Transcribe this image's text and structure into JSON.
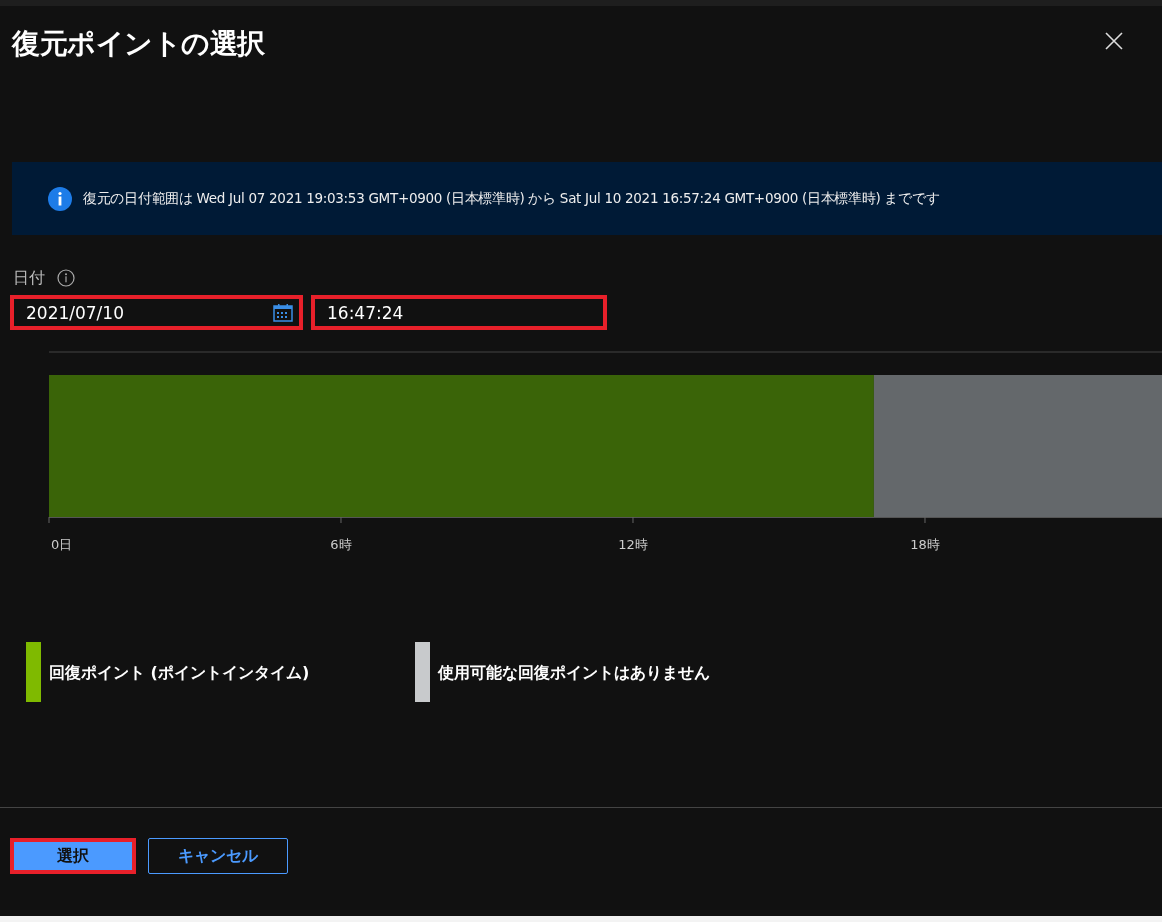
{
  "title": "復元ポイントの選択",
  "info": {
    "text": "復元の日付範囲は Wed Jul 07 2021 19:03:53 GMT+0900 (日本標準時) から Sat Jul 10 2021 16:57:24 GMT+0900 (日本標準時) までです"
  },
  "date_label": "日付",
  "date_field": {
    "value": "2021/07/10",
    "highlighted": true
  },
  "time_field": {
    "value": "16:47:24",
    "highlighted": true
  },
  "timeline": {
    "chart_data": {
      "type": "bar",
      "orientation": "horizontal",
      "stacked": true,
      "xlim": [
        0,
        22.87
      ],
      "xticks": [
        {
          "value": 0,
          "label": "0日"
        },
        {
          "value": 6,
          "label": "6時"
        },
        {
          "value": 12,
          "label": "12時"
        },
        {
          "value": 18,
          "label": "18時"
        }
      ],
      "series": [
        {
          "color": "#3a6408",
          "values": [
            16.95
          ]
        },
        {
          "color": "#64686b",
          "values": [
            5.92
          ]
        }
      ]
    }
  },
  "legend": [
    {
      "label": "回復ポイント (ポイントインタイム)",
      "color": "#7fba00"
    },
    {
      "label": "使用可能な回復ポイントはありません",
      "color": "#c8cacc"
    }
  ],
  "buttons": [
    {
      "label": "選択",
      "kind": "primary",
      "highlighted": true
    },
    {
      "label": "キャンセル",
      "kind": "secondary",
      "highlighted": false
    }
  ]
}
